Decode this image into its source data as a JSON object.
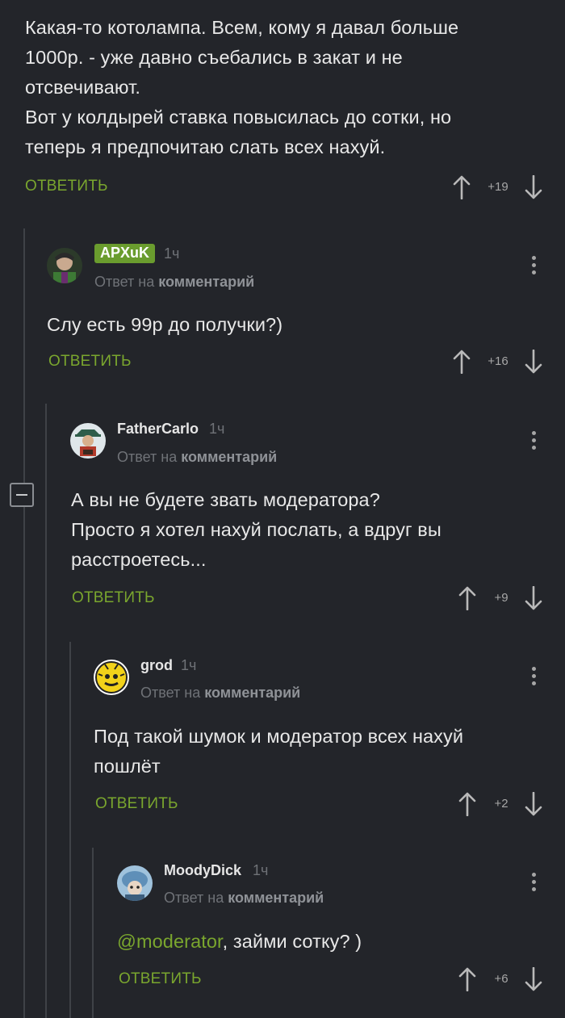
{
  "comments": [
    {
      "id": "c0",
      "text_lines": [
        "Какая-то котолампа. Всем, кому я давал больше",
        "1000р. - уже давно съебались в закат и не",
        "отсвечивают.",
        "Вот у колдырей ставка повысилась до сотки, но",
        "теперь я предпочитаю слать всех нахуй."
      ],
      "reply_label": "ОТВЕТИТЬ",
      "rating": "+19"
    },
    {
      "id": "c1",
      "username": "APXuK",
      "time": "1ч",
      "reply_to_prefix": "Ответ на",
      "reply_to_target": "комментарий",
      "text_lines": [
        "Слу есть 99р до получки?)"
      ],
      "reply_label": "ОТВЕТИТЬ",
      "rating": "+16"
    },
    {
      "id": "c2",
      "username": "FatherCarlo",
      "time": "1ч",
      "reply_to_prefix": "Ответ на",
      "reply_to_target": "комментарий",
      "text_lines": [
        "А вы не будете звать модератора?",
        "Просто я хотел нахуй послать, а вдруг вы",
        "расстроетесь..."
      ],
      "reply_label": "ОТВЕТИТЬ",
      "rating": "+9"
    },
    {
      "id": "c3",
      "username": "grod",
      "time": "1ч",
      "reply_to_prefix": "Ответ на",
      "reply_to_target": "комментарий",
      "text_lines": [
        "Под такой шумок и модератор всех нахуй",
        "пошлёт"
      ],
      "reply_label": "ОТВЕТИТЬ",
      "rating": "+2"
    },
    {
      "id": "c4",
      "username": "MoodyDick",
      "time": "1ч",
      "reply_to_prefix": "Ответ на",
      "reply_to_target": "комментарий",
      "mention": "@moderator",
      "text_after_mention": ", займи сотку? )",
      "reply_label": "ОТВЕТИТЬ",
      "rating": "+6"
    }
  ],
  "colors": {
    "background": "#23252a",
    "accent_green": "#7aa62e",
    "badge_green": "#6a9c2e",
    "muted": "#6f7277"
  }
}
